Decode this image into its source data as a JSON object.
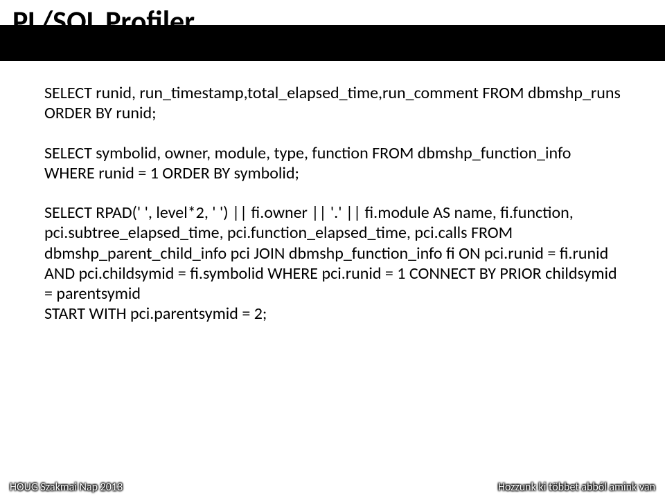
{
  "title": "PL/SQL Profiler",
  "paragraphs": [
    "SELECT runid, run_timestamp,total_elapsed_time,run_comment FROM dbmshp_runs ORDER BY runid;",
    "SELECT symbolid, owner, module, type, function FROM dbmshp_function_info WHERE  runid = 1  ORDER BY symbolid;",
    "SELECT RPAD(' ', level*2, ' ') || fi.owner || '.' || fi.module AS name, fi.function, pci.subtree_elapsed_time, pci.function_elapsed_time, pci.calls FROM   dbmshp_parent_child_info pci  JOIN dbmshp_function_info fi ON pci.runid = fi.runid AND pci.childsymid = fi.symbolid  WHERE  pci.runid = 1 CONNECT BY PRIOR childsymid = parentsymid\nSTART WITH pci.parentsymid = 2;"
  ],
  "footer": {
    "left": "HOUG Szakmai Nap 2013",
    "right": "Hozzunk ki többet abból amink van"
  }
}
